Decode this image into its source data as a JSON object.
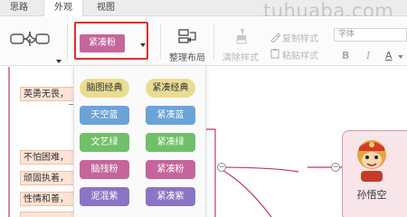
{
  "tabs": [
    "思路",
    "外观",
    "视图"
  ],
  "ribbon": {
    "theme_button": "紧凑粉",
    "arrange_label": "整理布局",
    "clear_style_label": "清除样式",
    "copy_style_label": "复制样式",
    "paste_style_label": "粘贴样式",
    "font_placeholder": "字体",
    "bold": "B",
    "italic": "I",
    "font_color": "A"
  },
  "theme_menu": [
    {
      "label": "脑图经典",
      "bg": "#e9dc93",
      "fg": "#333333",
      "pill": true
    },
    {
      "label": "紧凑经典",
      "bg": "#e9dc93",
      "fg": "#333333",
      "pill": true
    },
    {
      "label": "天空蓝",
      "bg": "#6ba3d6",
      "fg": "#ffffff",
      "pill": false
    },
    {
      "label": "紧凑蓝",
      "bg": "#6ba3d6",
      "fg": "#ffffff",
      "pill": false
    },
    {
      "label": "文艺绿",
      "bg": "#72bf6a",
      "fg": "#ffffff",
      "pill": false
    },
    {
      "label": "紧凑绿",
      "bg": "#72bf6a",
      "fg": "#ffffff",
      "pill": false
    },
    {
      "label": "脑残粉",
      "bg": "#c5659b",
      "fg": "#ffffff",
      "pill": false
    },
    {
      "label": "紧凑粉",
      "bg": "#c5659b",
      "fg": "#ffffff",
      "pill": false
    },
    {
      "label": "泥混紫",
      "bg": "#8a74c4",
      "fg": "#ffffff",
      "pill": false
    },
    {
      "label": "紧凑紫",
      "bg": "#8a74c4",
      "fg": "#ffffff",
      "pill": false
    }
  ],
  "canvas": {
    "topics": [
      "英勇无畏，",
      "不怕困难，",
      "顽固执着，",
      "性情和善，",
      ""
    ],
    "central_label": "孙悟空"
  },
  "watermark": "tuhuaba.com",
  "colors": {
    "accent_highlight": "#e52b2b",
    "topic_bg": "#fde4d6",
    "line_color": "#c0395b"
  }
}
